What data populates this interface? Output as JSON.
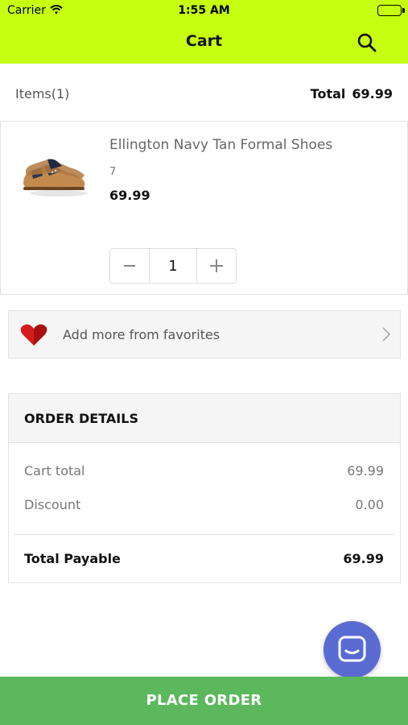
{
  "status": {
    "carrier": "Carrier",
    "time": "1:55 AM"
  },
  "header": {
    "title": "Cart"
  },
  "summary": {
    "items_label": "Items(1)",
    "total_label": "Total",
    "total_value": "69.99"
  },
  "product": {
    "name": "Ellington Navy Tan Formal Shoes",
    "size": "7",
    "price": "69.99",
    "quantity": "1"
  },
  "favorites": {
    "label": "Add more from favorites"
  },
  "order": {
    "title": "ORDER DETAILS",
    "rows": [
      {
        "label": "Cart total",
        "value": "69.99"
      },
      {
        "label": "Discount",
        "value": "0.00"
      }
    ],
    "payable_label": "Total Payable",
    "payable_value": "69.99"
  },
  "footer": {
    "place_order": "PLACE ORDER"
  },
  "colors": {
    "header": "#c6ff0f",
    "place_order": "#5cb85c",
    "chat": "#5a6bd2"
  },
  "icons": [
    "wifi-icon",
    "battery-icon",
    "search-icon",
    "shoe-image",
    "minus-icon",
    "plus-icon",
    "heart-icon",
    "chevron-right-icon",
    "chat-icon"
  ]
}
